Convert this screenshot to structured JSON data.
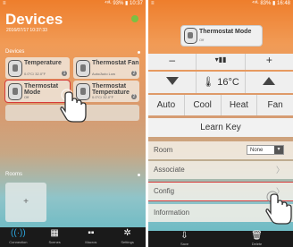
{
  "left": {
    "status": {
      "signal": "≡",
      "right": "⁴ˢᴵᴸ 93% ▮ 10:37"
    },
    "title": "Devices",
    "timestamp": "2016/07/17 10:37:33",
    "devices_label": "Devices",
    "rooms_label": "Rooms",
    "cards": [
      {
        "name": "Temperature",
        "sub": "0.0°C/ 32.0°F",
        "badge": "1"
      },
      {
        "name": "Thermostat Fan",
        "sub": "Auto/Auto Low",
        "badge": "2"
      },
      {
        "name": "Thermostat Mode",
        "sub": "Off",
        "badge": ""
      },
      {
        "name": "Thermostat Temperature",
        "sub": "0.0°C/ 32.0°F",
        "badge": "2"
      }
    ],
    "add_label": "+",
    "room_add_label": "+",
    "tabs": [
      {
        "icon": "((·))",
        "label": "Connection"
      },
      {
        "icon": "▦",
        "label": "Scenes"
      },
      {
        "icon": "▪▪",
        "label": "Macros"
      },
      {
        "icon": "✲",
        "label": "Settings"
      }
    ]
  },
  "right": {
    "status": {
      "signal": "≡",
      "right": "⁴ˢᴵᴸ 83% ▮ 16:48"
    },
    "popup": {
      "title": "Thermostat Mode",
      "sub": "Off"
    },
    "top_row": [
      "–",
      "▾▮▮",
      "+"
    ],
    "temp": "16°C",
    "modes": [
      "Auto",
      "Cool",
      "Heat",
      "Fan"
    ],
    "learn_key": "Learn Key",
    "room_label": "Room",
    "room_value": "None",
    "rows": [
      "Associate",
      "Config",
      "Information"
    ],
    "chevron": "〉",
    "bottom": [
      {
        "icon": "⇩",
        "label": "Save"
      },
      {
        "icon": "🗑",
        "label": "Delete"
      }
    ]
  }
}
